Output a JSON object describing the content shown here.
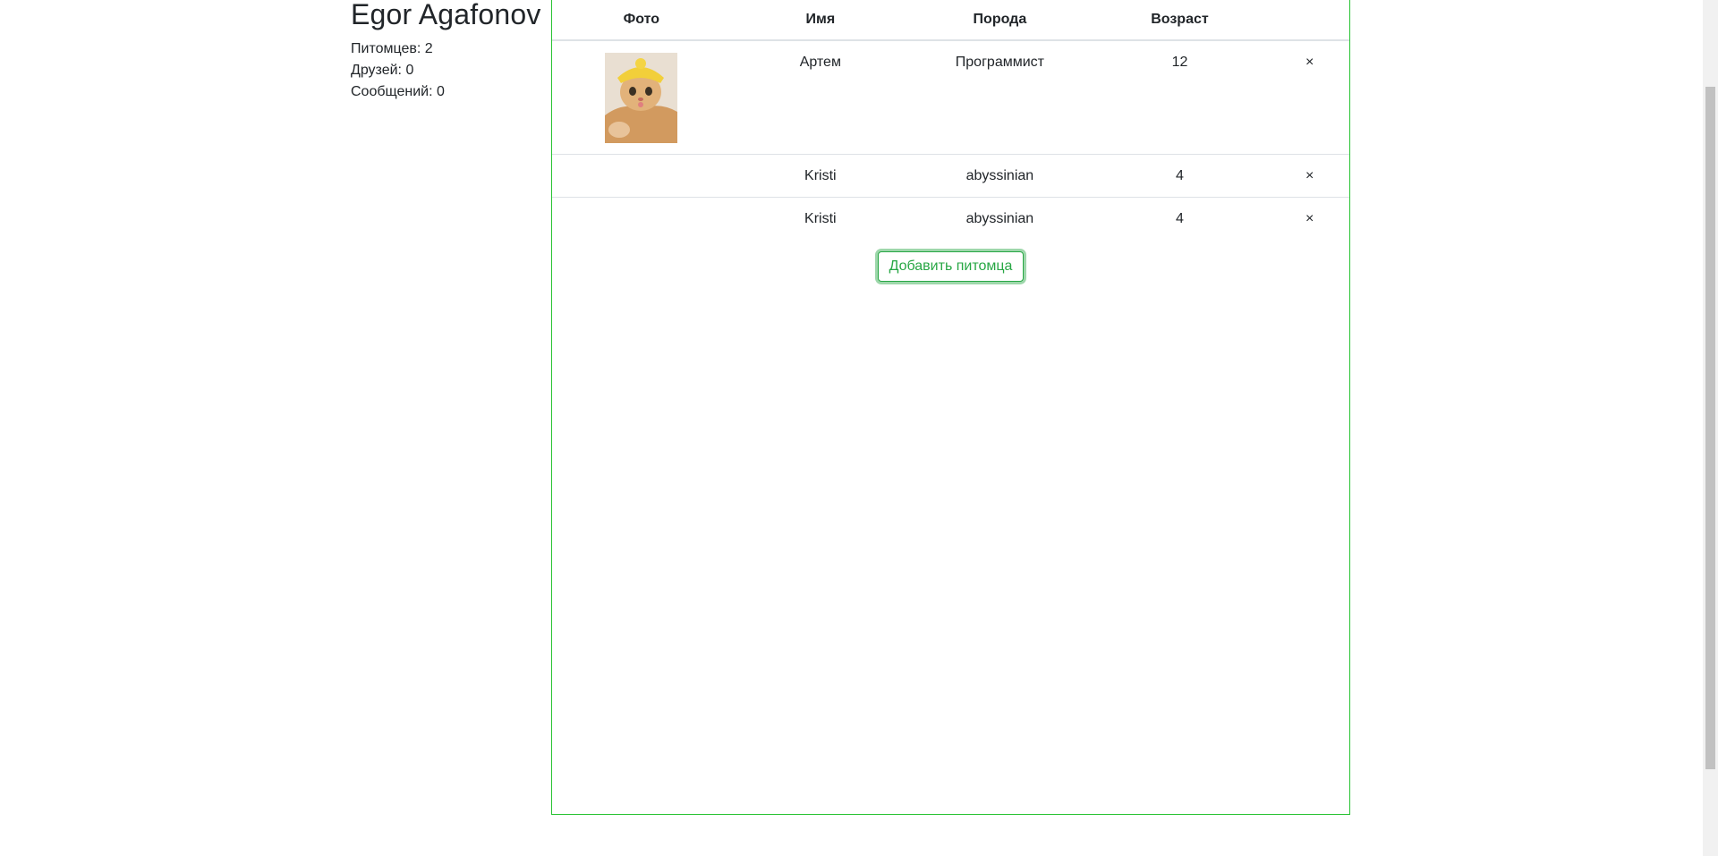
{
  "profile": {
    "name": "Egor Agafonov",
    "stats": {
      "pets": "Питомцев: 2",
      "friends": "Друзей: 0",
      "messages": "Сообщений: 0"
    }
  },
  "pets_table": {
    "headers": [
      "Фото",
      "Имя",
      "Порода",
      "Возраст",
      ""
    ],
    "rows": [
      {
        "has_photo": true,
        "photo_alt": "cat photo",
        "name": "Артем",
        "breed": "Программист",
        "age": "12",
        "delete": "×"
      },
      {
        "has_photo": false,
        "name": "Kristi",
        "breed": "abyssinian",
        "age": "4",
        "delete": "×"
      },
      {
        "has_photo": false,
        "name": "Kristi",
        "breed": "abyssinian",
        "age": "4",
        "delete": "×"
      }
    ]
  },
  "add_pet_button": "Добавить питомца",
  "colors": {
    "panel_border": "#28c332",
    "button_accent": "#28a745",
    "text": "#212529",
    "row_divider": "#dee2e6"
  }
}
